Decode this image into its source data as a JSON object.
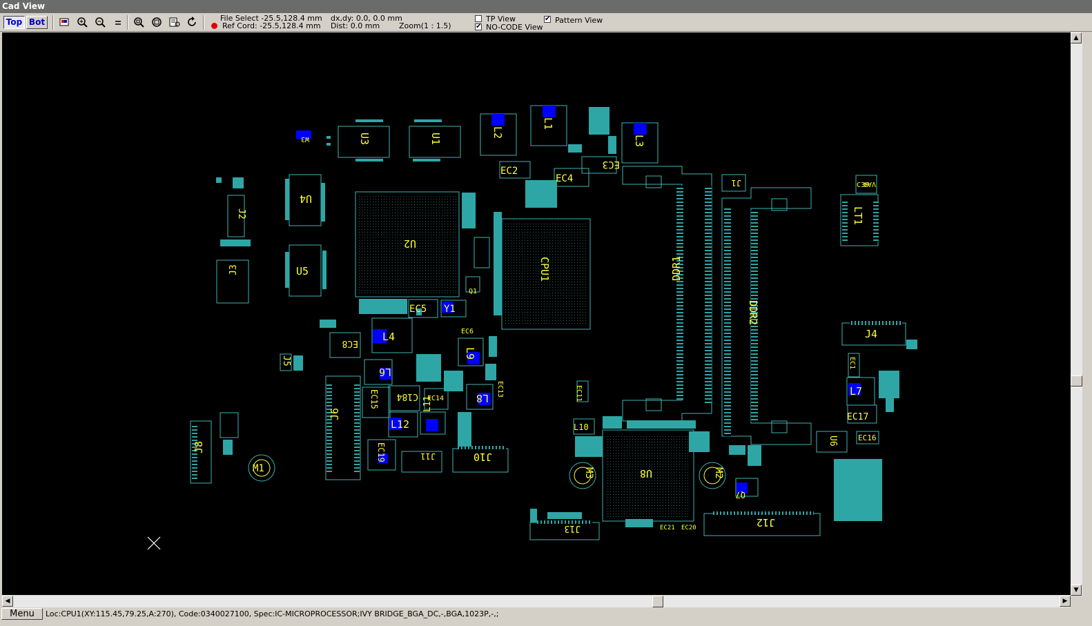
{
  "window": {
    "title": "Cad View"
  },
  "toolbar": {
    "top_label": "Top",
    "bot_label": "Bot",
    "file_select": "File Select -25.5,128.4 mm",
    "ref_cord": "Ref Cord: -25.5,128.4 mm",
    "dxdy": "dx,dy: 0.0, 0.0 mm",
    "dist": "Dist: 0.0 mm",
    "zoom": "Zoom(1 : 1.5)",
    "tp_view": {
      "label": "TP View",
      "checked": false
    },
    "nocode_view": {
      "label": "NO-CODE View",
      "checked": true
    },
    "pattern_view": {
      "label": "Pattern View",
      "checked": true
    }
  },
  "colors": {
    "outline": "#3fb5b5",
    "label": "#ffff33",
    "pad": "#0000ff",
    "background": "#000000"
  },
  "components": {
    "CPU1": "CPU1",
    "U2": "U2",
    "U3": "U3",
    "U1": "U1",
    "U4": "U4",
    "U5": "U5",
    "U6": "U6",
    "U8": "U8",
    "DDR1": "DDR1",
    "DDR2": "DDR2",
    "J2": "J2",
    "J3": "J3",
    "J4": "J4",
    "J5": "J5",
    "J6": "J6",
    "J8": "J8",
    "J10": "J10",
    "J11": "J11",
    "J12": "J12",
    "J13": "J13",
    "L1": "L1",
    "L2": "L2",
    "L3": "L3",
    "L4": "L4",
    "L7": "L7",
    "L8": "L8",
    "L9": "L9",
    "L6": "L6",
    "L10": "L10",
    "L11": "L11",
    "L12": "L12",
    "LT1": "LT1",
    "EC2": "EC2",
    "EC3": "EC3",
    "EC4": "EC4",
    "EC5": "EC5",
    "EC6": "EC6",
    "EC8": "EC8",
    "EC15": "EC15",
    "EC16": "EC16",
    "EC17": "EC17",
    "EC19": "EC19",
    "EC21": "EC21",
    "EC20": "EC20",
    "EC1": "EC1",
    "EC11": "EC11",
    "EC13": "EC13",
    "EC14": "EC14",
    "C184": "C184",
    "C39": "C39",
    "VA4": "VA4",
    "Y1": "Y1",
    "M1": "M1",
    "M2": "M2",
    "M3": "M3",
    "W3": "W3",
    "J1": "J1",
    "Q1": "Q1",
    "Q7": "Q7"
  },
  "status": {
    "menu_label": "Menu",
    "text": "Loc:CPU1(XY:115.45,79.25,A:270), Code:0340027100, Spec:IC-MICROPROCESSOR;IVY BRIDGE_BGA_DC,-,BGA,1023P,-,;"
  }
}
